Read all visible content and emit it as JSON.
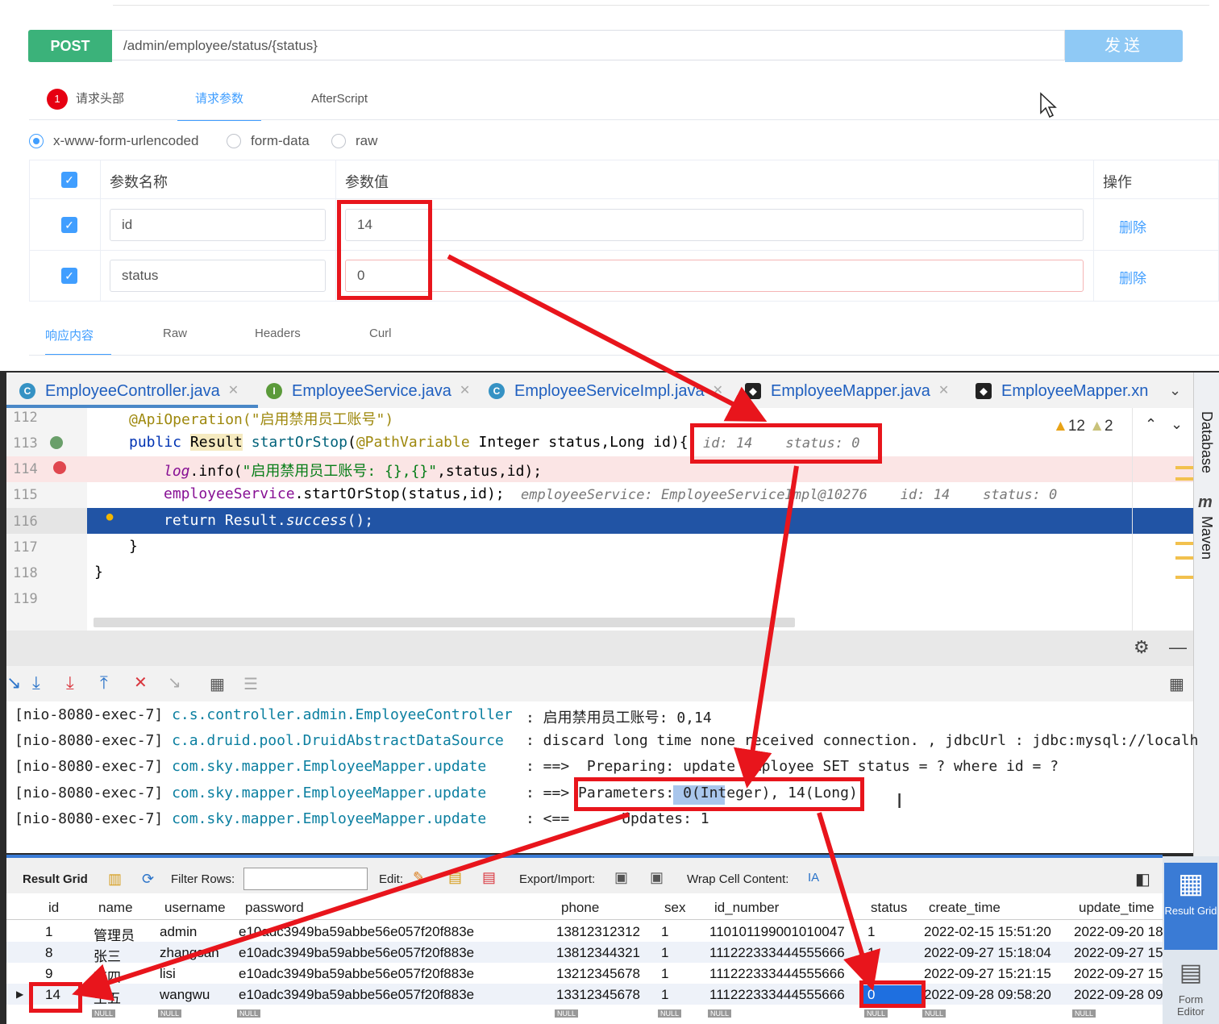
{
  "api": {
    "method": "POST",
    "url": "/admin/employee/status/{status}",
    "send": "发送",
    "tabs": [
      {
        "label": "请求头部",
        "badge": "1"
      },
      {
        "label": "请求参数"
      },
      {
        "label": "AfterScript"
      }
    ],
    "body_types": [
      "x-www-form-urlencoded",
      "form-data",
      "raw"
    ],
    "param_headers": [
      "参数名称",
      "参数值",
      "操作"
    ],
    "params": [
      {
        "name": "id",
        "value": "14",
        "action": "删除"
      },
      {
        "name": "status",
        "value": "0",
        "action": "删除"
      }
    ],
    "response_tabs": [
      "响应内容",
      "Raw",
      "Headers",
      "Curl"
    ]
  },
  "ide": {
    "tabs": [
      {
        "label": "EmployeeController.java",
        "icon": "C"
      },
      {
        "label": "EmployeeService.java",
        "icon": "I"
      },
      {
        "label": "EmployeeServiceImpl.java",
        "icon": "C"
      },
      {
        "label": "EmployeeMapper.java",
        "icon": "mybatis-bird"
      },
      {
        "label": "EmployeeMapper.xn",
        "icon": "mybatis-bird"
      }
    ],
    "line_numbers": [
      "112",
      "113",
      "114",
      "115",
      "116",
      "117",
      "118",
      "119"
    ],
    "code": {
      "l112": "@ApiOperation(\"启用禁用员工账号\")",
      "l113_kw": "public",
      "l113_type": "Result",
      "l113_name": "startOrStop",
      "l113_ann": "@PathVariable",
      "l113_rest": " Integer status,Long id){",
      "l113_hint": "id: 14    status: 0",
      "l114_log": "log",
      "l114_rest": ".info(",
      "l114_str": "\"启用禁用员工账号: {},{}\"",
      "l114_end": ",status,id);",
      "l115_field": "employeeService",
      "l115_rest": ".startOrStop(status,id);",
      "l115_hint": "employeeService: EmployeeServiceImpl@10276    id: 14    status: 0",
      "l116": "return Result.",
      "l116_m": "success",
      "l116_end": "();",
      "l117": "}",
      "l118": "}"
    },
    "warnings": "12",
    "weak_warnings": "2",
    "side_tools": [
      "Database",
      "Maven"
    ]
  },
  "console": {
    "lines": [
      {
        "thread": "[nio-8080-exec-7]",
        "cls": "c.s.controller.admin.EmployeeController",
        "msg": ": 启用禁用员工账号: 0,14"
      },
      {
        "thread": "[nio-8080-exec-7]",
        "cls": "c.a.druid.pool.DruidAbstractDataSource",
        "msg": ": discard long time none received connection. , jdbcUrl : jdbc:mysql://localh"
      },
      {
        "thread": "[nio-8080-exec-7]",
        "cls": "com.sky.mapper.EmployeeMapper.update",
        "msg": ": ==>  Preparing: update employee SET status = ? where id = ?"
      },
      {
        "thread": "[nio-8080-exec-7]",
        "cls": "com.sky.mapper.EmployeeMapper.update",
        "msg": ": ==> Parameters: 0(Integer), 14(Long)"
      },
      {
        "thread": "[nio-8080-exec-7]",
        "cls": "com.sky.mapper.EmployeeMapper.update",
        "msg": ": <==      Updates: 1"
      }
    ]
  },
  "grid": {
    "toolbar": {
      "result_grid": "Result Grid",
      "filter_rows": "Filter Rows:",
      "edit": "Edit:",
      "export": "Export/Import:",
      "wrap": "Wrap Cell Content:"
    },
    "side": {
      "result_grid": "Result Grid",
      "form_editor": "Form Editor"
    },
    "columns": [
      "id",
      "name",
      "username",
      "password",
      "phone",
      "sex",
      "id_number",
      "status",
      "create_time",
      "update_time"
    ],
    "rows": [
      [
        "1",
        "管理员",
        "admin",
        "e10adc3949ba59abbe56e057f20f883e",
        "13812312312",
        "1",
        "110101199001010047",
        "1",
        "2022-02-15 15:51:20",
        "2022-09-20 18"
      ],
      [
        "8",
        "张三",
        "zhangsan",
        "e10adc3949ba59abbe56e057f20f883e",
        "13812344321",
        "1",
        "111222333444555666",
        "1",
        "2022-09-27 15:18:04",
        "2022-09-27 15"
      ],
      [
        "9",
        "李四",
        "lisi",
        "e10adc3949ba59abbe56e057f20f883e",
        "13212345678",
        "1",
        "111222333444555666",
        "1",
        "2022-09-27 15:21:15",
        "2022-09-27 15"
      ],
      [
        "14",
        "王五",
        "wangwu",
        "e10adc3949ba59abbe56e057f20f883e",
        "13312345678",
        "1",
        "111222333444555666",
        "0",
        "2022-09-28 09:58:20",
        "2022-09-28 09"
      ]
    ],
    "null_label": "NULL"
  },
  "colors": {
    "annotation_red": "#e8151c",
    "accent": "#409eff",
    "post_green": "#3bb27a"
  }
}
